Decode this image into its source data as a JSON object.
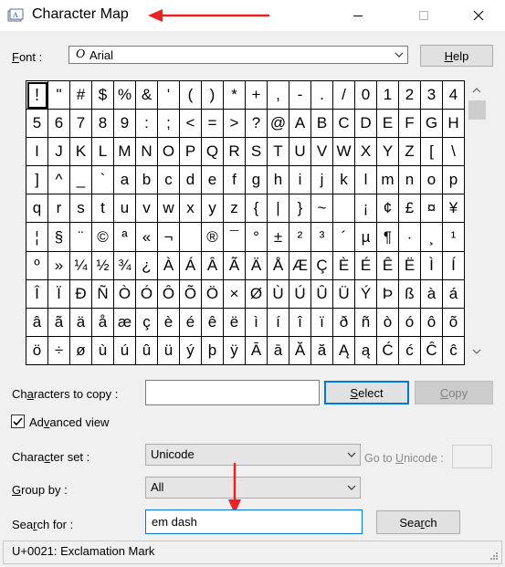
{
  "window": {
    "title": "Character Map",
    "minimize_icon": "minimize-icon",
    "maximize_icon": "maximize-icon",
    "close_icon": "close-icon"
  },
  "font": {
    "label_prefix": "",
    "label_access": "F",
    "label_rest": "ont :",
    "type_icon": "O",
    "value": "Arial"
  },
  "help_button": {
    "access": "H",
    "rest": "elp"
  },
  "grid": {
    "selected_index": 0,
    "chars": [
      "!",
      "\"",
      "#",
      "$",
      "%",
      "&",
      "'",
      "(",
      ")",
      "*",
      "+",
      ",",
      "-",
      ".",
      "/",
      "0",
      "1",
      "2",
      "3",
      "4",
      "5",
      "6",
      "7",
      "8",
      "9",
      ":",
      ";",
      "<",
      "=",
      ">",
      "?",
      "@",
      "A",
      "B",
      "C",
      "D",
      "E",
      "F",
      "G",
      "H",
      "I",
      "J",
      "K",
      "L",
      "M",
      "N",
      "O",
      "P",
      "Q",
      "R",
      "S",
      "T",
      "U",
      "V",
      "W",
      "X",
      "Y",
      "Z",
      "[",
      "\\",
      "]",
      "^",
      "_",
      "`",
      "a",
      "b",
      "c",
      "d",
      "e",
      "f",
      "g",
      "h",
      "i",
      "j",
      "k",
      "l",
      "m",
      "n",
      "o",
      "p",
      "q",
      "r",
      "s",
      "t",
      "u",
      "v",
      "w",
      "x",
      "y",
      "z",
      "{",
      "|",
      "}",
      "~",
      " ",
      "¡",
      "¢",
      "£",
      "¤",
      "¥",
      "¦",
      "§",
      "¨",
      "©",
      "ª",
      "«",
      "¬",
      "­",
      "®",
      "¯",
      "°",
      "±",
      "²",
      "³",
      "´",
      "µ",
      "¶",
      "·",
      "¸",
      "¹",
      "º",
      "»",
      "¼",
      "½",
      "¾",
      "¿",
      "À",
      "Á",
      "Â",
      "Ã",
      "Ä",
      "Å",
      "Æ",
      "Ç",
      "È",
      "É",
      "Ê",
      "Ë",
      "Ì",
      "Í",
      "Î",
      "Ï",
      "Ð",
      "Ñ",
      "Ò",
      "Ó",
      "Ô",
      "Õ",
      "Ö",
      "×",
      "Ø",
      "Ù",
      "Ú",
      "Û",
      "Ü",
      "Ý",
      "Þ",
      "ß",
      "à",
      "á",
      "â",
      "ã",
      "ä",
      "å",
      "æ",
      "ç",
      "è",
      "é",
      "ê",
      "ë",
      "ì",
      "í",
      "î",
      "ï",
      "ð",
      "ñ",
      "ò",
      "ó",
      "ô",
      "õ",
      "ö",
      "÷",
      "ø",
      "ù",
      "ú",
      "û",
      "ü",
      "ý",
      "þ",
      "ÿ",
      "Ā",
      "ā",
      "Ă",
      "ă",
      "Ą",
      "ą",
      "Ć",
      "ć",
      "Ĉ",
      "ĉ"
    ]
  },
  "copy": {
    "label_pre": "Ch",
    "label_access": "a",
    "label_rest": "racters to copy :",
    "value": "",
    "select_access": "S",
    "select_rest": "elect",
    "copy_access": "C",
    "copy_rest": "opy"
  },
  "advanced": {
    "checked": true,
    "label_pre": "Ad",
    "label_access": "v",
    "label_rest": "anced view"
  },
  "charset": {
    "label_pre": "Chara",
    "label_access": "c",
    "label_rest": "ter set :",
    "value": "Unicode",
    "goto_pre": "Go to ",
    "goto_access": "U",
    "goto_rest": "nicode :",
    "goto_value": ""
  },
  "groupby": {
    "label_access": "G",
    "label_rest": "roup by :",
    "value": "All"
  },
  "search": {
    "label_pre": "Sea",
    "label_access": "r",
    "label_rest": "ch for :",
    "value": "em dash",
    "button_pre": "Sea",
    "button_access": "r",
    "button_rest": "ch"
  },
  "status": {
    "text": "U+0021: Exclamation Mark"
  },
  "colors": {
    "annotation_arrow": "#e8212b",
    "focus_blue": "#0078d7"
  }
}
